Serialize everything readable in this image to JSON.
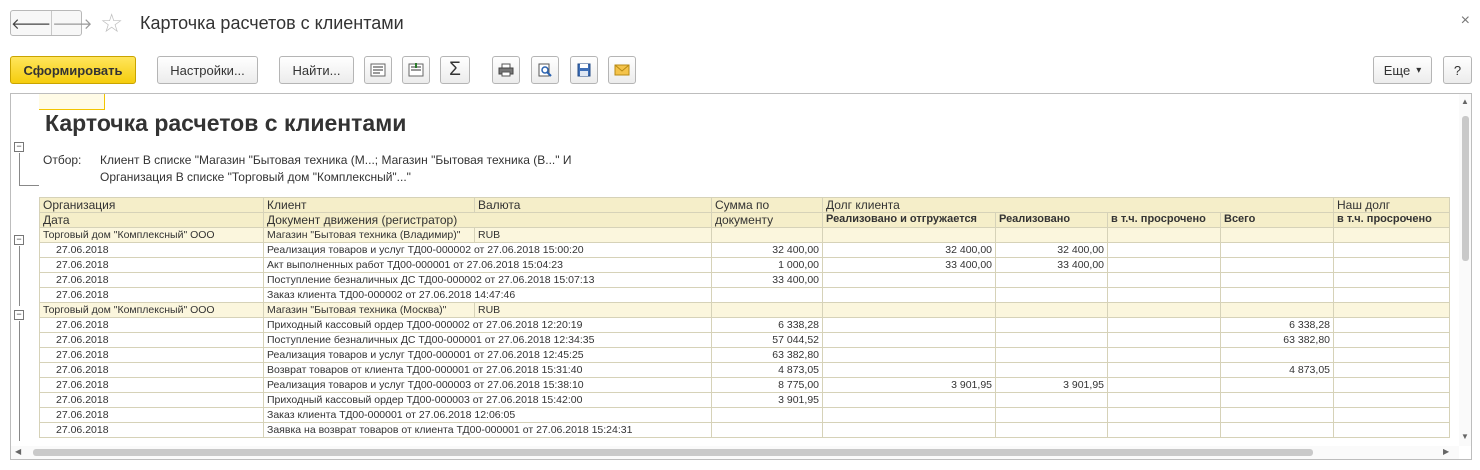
{
  "window": {
    "title": "Карточка расчетов с клиентами",
    "back_glyph": "🡐",
    "forward_glyph": "🡒",
    "star_glyph": "☆",
    "close_glyph": "×"
  },
  "toolbar": {
    "generate": "Сформировать",
    "settings": "Настройки...",
    "find": "Найти...",
    "more": "Еще",
    "more_arrow": "▾",
    "help": "?",
    "sum_glyph": "Σ"
  },
  "report": {
    "title": "Карточка расчетов с клиентами",
    "filter_label": "Отбор:",
    "filter_line1": "Клиент В списке \"Магазин \"Бытовая техника (М...; Магазин \"Бытовая техника (В...\" И",
    "filter_line2": "Организация В списке \"Торговый дом \"Комплексный\"...\"",
    "group_glyph": "−",
    "headers": {
      "organization": "Организация",
      "client": "Клиент",
      "currency": "Валюта",
      "doc_sum_1": "Сумма по",
      "doc_sum_2": "документу",
      "client_debt": "Долг клиента",
      "our_debt": "Наш долг",
      "date": "Дата",
      "document": "Документ движения (регистратор)",
      "realized_shipped": "Реализовано и отгружается",
      "realized": "Реализовано",
      "overdue": "в т.ч. просрочено",
      "total": "Всего",
      "our_overdue": "в т.ч. просрочено"
    },
    "groups": [
      {
        "organization": "Торговый дом \"Комплексный\" ООО",
        "client": "Магазин \"Бытовая техника (Владимир)\"",
        "currency": "RUB",
        "rows": [
          {
            "date": "27.06.2018",
            "doc": "Реализация товаров и услуг ТД00-000002 от 27.06.2018 15:00:20",
            "sum": "32 400,00",
            "rs": "32 400,00",
            "r": "32 400,00",
            "ov": "",
            "total": "",
            "ov2": ""
          },
          {
            "date": "27.06.2018",
            "doc": "Акт выполненных работ ТД00-000001 от 27.06.2018 15:04:23",
            "sum": "1 000,00",
            "rs": "33 400,00",
            "r": "33 400,00",
            "ov": "",
            "total": "",
            "ov2": ""
          },
          {
            "date": "27.06.2018",
            "doc": "Поступление безналичных ДС ТД00-000002 от 27.06.2018 15:07:13",
            "sum": "33 400,00",
            "rs": "",
            "r": "",
            "ov": "",
            "total": "",
            "ov2": ""
          },
          {
            "date": "27.06.2018",
            "doc": "Заказ клиента ТД00-000002 от 27.06.2018 14:47:46",
            "sum": "",
            "rs": "",
            "r": "",
            "ov": "",
            "total": "",
            "ov2": ""
          }
        ]
      },
      {
        "organization": "Торговый дом \"Комплексный\" ООО",
        "client": "Магазин \"Бытовая техника (Москва)\"",
        "currency": "RUB",
        "rows": [
          {
            "date": "27.06.2018",
            "doc": "Приходный кассовый ордер ТД00-000002 от 27.06.2018 12:20:19",
            "sum": "6 338,28",
            "rs": "",
            "r": "",
            "ov": "",
            "total": "6 338,28",
            "ov2": ""
          },
          {
            "date": "27.06.2018",
            "doc": "Поступление безналичных ДС ТД00-000001 от 27.06.2018 12:34:35",
            "sum": "57 044,52",
            "rs": "",
            "r": "",
            "ov": "",
            "total": "63 382,80",
            "ov2": ""
          },
          {
            "date": "27.06.2018",
            "doc": "Реализация товаров и услуг ТД00-000001 от 27.06.2018 12:45:25",
            "sum": "63 382,80",
            "rs": "",
            "r": "",
            "ov": "",
            "total": "",
            "ov2": ""
          },
          {
            "date": "27.06.2018",
            "doc": "Возврат товаров от клиента ТД00-000001 от 27.06.2018 15:31:40",
            "sum": "4 873,05",
            "rs": "",
            "r": "",
            "ov": "",
            "total": "4 873,05",
            "ov2": ""
          },
          {
            "date": "27.06.2018",
            "doc": "Реализация товаров и услуг ТД00-000003 от 27.06.2018 15:38:10",
            "sum": "8 775,00",
            "rs": "3 901,95",
            "r": "3 901,95",
            "ov": "",
            "total": "",
            "ov2": ""
          },
          {
            "date": "27.06.2018",
            "doc": "Приходный кассовый ордер ТД00-000003 от 27.06.2018 15:42:00",
            "sum": "3 901,95",
            "rs": "",
            "r": "",
            "ov": "",
            "total": "",
            "ov2": ""
          },
          {
            "date": "27.06.2018",
            "doc": "Заказ клиента ТД00-000001 от 27.06.2018 12:06:05",
            "sum": "",
            "rs": "",
            "r": "",
            "ov": "",
            "total": "",
            "ov2": ""
          },
          {
            "date": "27.06.2018",
            "doc": "Заявка на возврат товаров от клиента ТД00-000001 от 27.06.2018 15:24:31",
            "sum": "",
            "rs": "",
            "r": "",
            "ov": "",
            "total": "",
            "ov2": ""
          }
        ]
      }
    ]
  },
  "scroll": {
    "up": "▲",
    "down": "▼",
    "left": "◀",
    "right": "▶"
  }
}
